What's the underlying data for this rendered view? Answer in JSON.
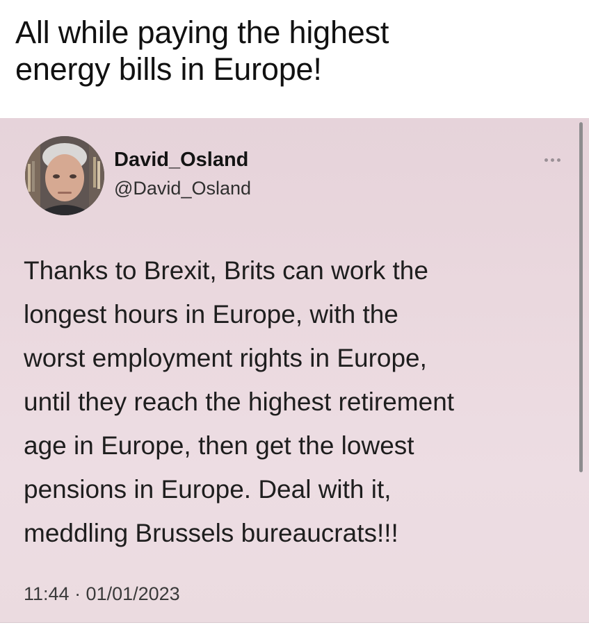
{
  "caption": "All while paying the highest\nenergy bills in Europe!",
  "tweet": {
    "author_name": "David_Osland",
    "author_handle": "@David_Osland",
    "text": "Thanks to Brexit, Brits can work the\nlongest hours in Europe, with the\nworst employment rights in Europe,\nuntil they reach the highest retirement\nage in Europe, then get the lowest\npensions in Europe. Deal with it,\nmeddling Brussels bureaucrats!!!",
    "timestamp": "11:44 · 01/01/2023",
    "more_icon": "more-options-icon"
  },
  "colors": {
    "card_background": "#eadae0",
    "text": "#1e1e1e",
    "scrollbar": "#8d8c8e"
  }
}
